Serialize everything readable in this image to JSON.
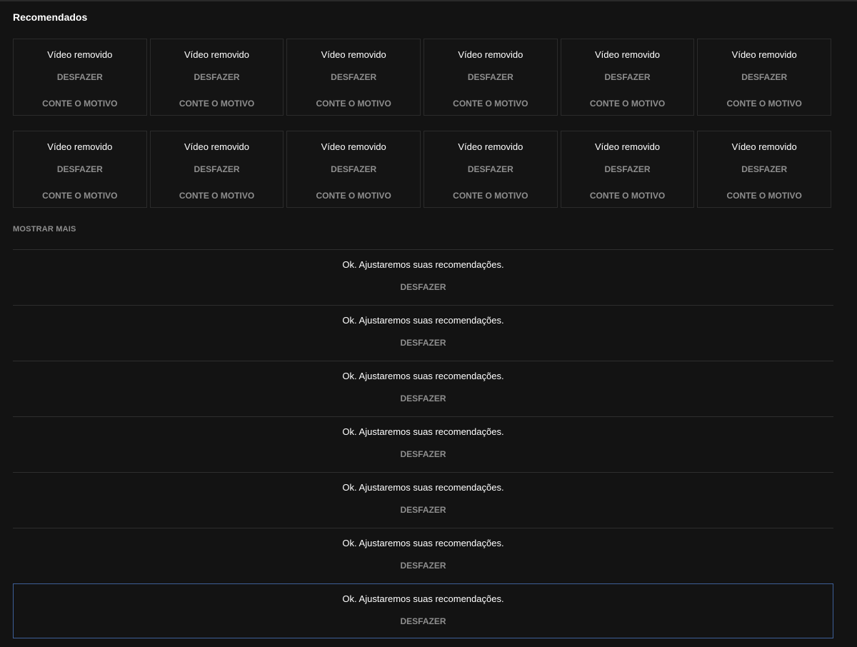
{
  "section": {
    "title": "Recomendados"
  },
  "tiles_row_1": [
    {
      "title": "Vídeo removido",
      "undo": "DESFAZER",
      "reason": "CONTE O MOTIVO"
    },
    {
      "title": "Vídeo removido",
      "undo": "DESFAZER",
      "reason": "CONTE O MOTIVO"
    },
    {
      "title": "Vídeo removido",
      "undo": "DESFAZER",
      "reason": "CONTE O MOTIVO"
    },
    {
      "title": "Vídeo removido",
      "undo": "DESFAZER",
      "reason": "CONTE O MOTIVO"
    },
    {
      "title": "Vídeo removido",
      "undo": "DESFAZER",
      "reason": "CONTE O MOTIVO"
    },
    {
      "title": "Vídeo removido",
      "undo": "DESFAZER",
      "reason": "CONTE O MOTIVO"
    }
  ],
  "tiles_row_2": [
    {
      "title": "Vídeo removido",
      "undo": "DESFAZER",
      "reason": "CONTE O MOTIVO"
    },
    {
      "title": "Vídeo removido",
      "undo": "DESFAZER",
      "reason": "CONTE O MOTIVO"
    },
    {
      "title": "Vídeo removido",
      "undo": "DESFAZER",
      "reason": "CONTE O MOTIVO"
    },
    {
      "title": "Vídeo removido",
      "undo": "DESFAZER",
      "reason": "CONTE O MOTIVO"
    },
    {
      "title": "Vídeo removido",
      "undo": "DESFAZER",
      "reason": "CONTE O MOTIVO"
    },
    {
      "title": "Vídeo removido",
      "undo": "DESFAZER",
      "reason": "CONTE O MOTIVO"
    }
  ],
  "show_more_label": "MOSTRAR MAIS",
  "feedback": [
    {
      "message": "Ok. Ajustaremos suas recomendações.",
      "undo": "DESFAZER"
    },
    {
      "message": "Ok. Ajustaremos suas recomendações.",
      "undo": "DESFAZER"
    },
    {
      "message": "Ok. Ajustaremos suas recomendações.",
      "undo": "DESFAZER"
    },
    {
      "message": "Ok. Ajustaremos suas recomendações.",
      "undo": "DESFAZER"
    },
    {
      "message": "Ok. Ajustaremos suas recomendações.",
      "undo": "DESFAZER"
    },
    {
      "message": "Ok. Ajustaremos suas recomendações.",
      "undo": "DESFAZER"
    },
    {
      "message": "Ok. Ajustaremos suas recomendações.",
      "undo": "DESFAZER"
    }
  ],
  "colors": {
    "background": "#131313",
    "text_primary": "#ffffff",
    "text_secondary": "#8e8e8e",
    "focus_border": "#3e5f98"
  }
}
